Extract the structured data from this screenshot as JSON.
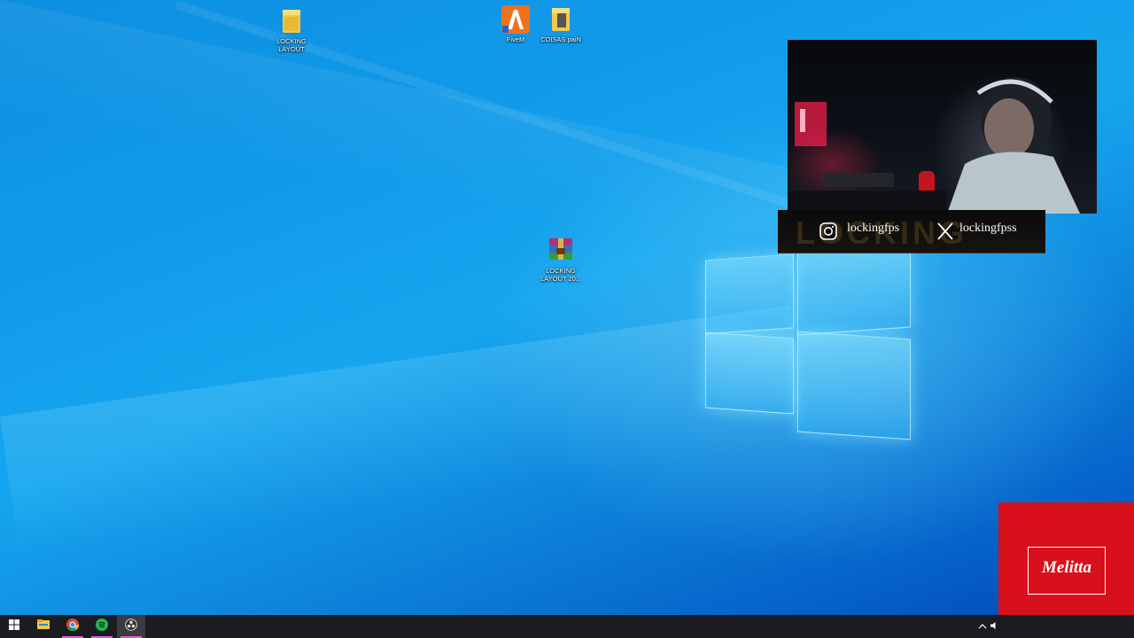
{
  "desktop": {
    "icons": [
      {
        "label": "LOCKING\nLAYOUT",
        "icon": "folder-icon"
      },
      {
        "label": "FiveM",
        "icon": "fivem-icon"
      },
      {
        "label": "COISAS paiN",
        "icon": "folder-icon"
      },
      {
        "label": "LOCKING\nLAYOUT 20...",
        "icon": "winrar-archive-icon"
      }
    ]
  },
  "overlay": {
    "instagram_handle": "lockingfps",
    "x_handle": "lockingfpss",
    "watermark": "LOCKING",
    "sponsor": "Melitta"
  },
  "taskbar": {
    "apps": [
      {
        "name": "start",
        "icon": "windows-start-icon"
      },
      {
        "name": "file-explorer",
        "icon": "file-explorer-icon"
      },
      {
        "name": "chrome",
        "icon": "chrome-icon"
      },
      {
        "name": "spotify",
        "icon": "spotify-icon"
      },
      {
        "name": "obs",
        "icon": "obs-icon"
      }
    ],
    "tray": [
      "chevron-up-icon",
      "volume-icon"
    ]
  },
  "colors": {
    "desktop_blue": "#129bea",
    "taskbar": "#1b1c1f",
    "melitta_red": "#d80f1d"
  }
}
